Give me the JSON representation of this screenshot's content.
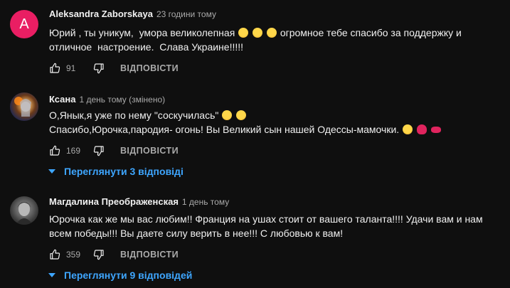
{
  "comments": [
    {
      "author": "Aleksandra Zaborskaya",
      "time": "23 години тому",
      "avatar_letter": "A",
      "line1_a": "Юрий , ты уникум,  умора великолепная ",
      "line1_b": " огромное тебе спасибо за поддержку и",
      "line2": "отличное  настроение.  Слава Украине!!!!!",
      "likes": "91",
      "reply_label": "ВІДПОВІСТИ"
    },
    {
      "author": "Ксана",
      "time": "1 день тому (змінено)",
      "line1_a": "О,Янык,я уже по нему \"соскучилась\" ",
      "line2_a": "Спасибо,Юрочка,пародия- огонь! Вы Великий сын нашей Одессы-мамочки. ",
      "likes": "169",
      "reply_label": "ВІДПОВІСТИ",
      "replies_label": "Переглянути 3 відповіді"
    },
    {
      "author": "Магдалина Преображенская",
      "time": "1 день тому",
      "line1": "Юрочка как же мы вас любим!! Франция на ушах стоит от вашего таланта!!!! Удачи вам и нам",
      "line2": "всем победы!!! Вы даете силу верить в нее!!! С любовью к вам!",
      "likes": "359",
      "reply_label": "ВІДПОВІСТИ",
      "replies_label": "Переглянути 9 відповідей"
    }
  ],
  "colors": {
    "background": "#0f0f0f",
    "text": "#f1f1f1",
    "secondary": "#aaaaaa",
    "link": "#3ea6ff",
    "avatar_a": "#e91e63"
  }
}
